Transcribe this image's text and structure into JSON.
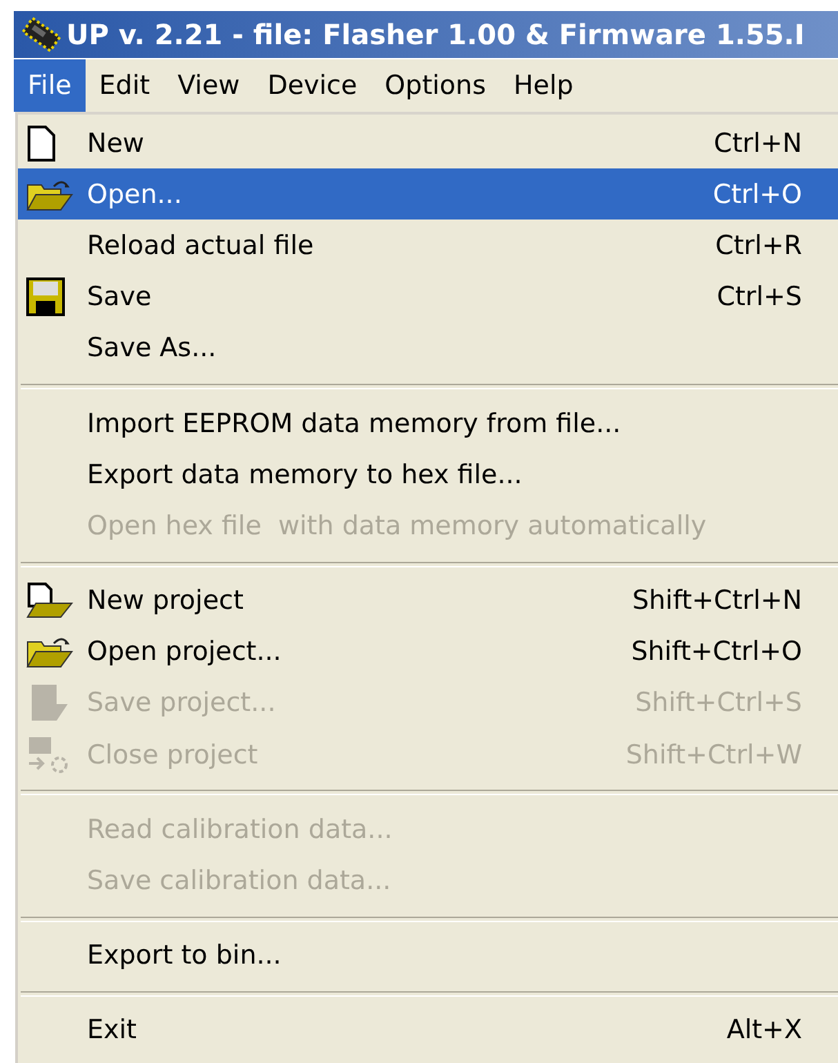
{
  "window": {
    "title": "UP v. 2.21 - file: Flasher 1.00 & Firmware 1.55.I"
  },
  "menubar": [
    {
      "label": "File",
      "selected": true
    },
    {
      "label": "Edit",
      "selected": false
    },
    {
      "label": "View",
      "selected": false
    },
    {
      "label": "Device",
      "selected": false
    },
    {
      "label": "Options",
      "selected": false
    },
    {
      "label": "Help",
      "selected": false
    }
  ],
  "menu": [
    {
      "kind": "document",
      "label": "New",
      "shortcut": "Ctrl+N",
      "selected": false,
      "disabled": false
    },
    {
      "kind": "folder",
      "label": "Open...",
      "shortcut": "Ctrl+O",
      "selected": true,
      "disabled": false
    },
    {
      "kind": "item",
      "label": "Reload actual file",
      "shortcut": "Ctrl+R",
      "selected": false,
      "disabled": false
    },
    {
      "kind": "disk",
      "label": "Save",
      "shortcut": "Ctrl+S",
      "selected": false,
      "disabled": false
    },
    {
      "kind": "item",
      "label": "Save As...",
      "selected": false,
      "disabled": false
    },
    {
      "kind": "separator"
    },
    {
      "kind": "item",
      "label": "Import EEPROM data memory from file...",
      "selected": false,
      "disabled": false
    },
    {
      "kind": "item",
      "label": "Export data memory to hex file...",
      "selected": false,
      "disabled": false
    },
    {
      "kind": "item",
      "label": "Open hex file  with data memory automatically",
      "selected": false,
      "disabled": true
    },
    {
      "kind": "separator"
    },
    {
      "kind": "new-project",
      "label": "New project",
      "shortcut": "Shift+Ctrl+N",
      "selected": false,
      "disabled": false
    },
    {
      "kind": "folder",
      "label": "Open project...",
      "shortcut": "Shift+Ctrl+O",
      "selected": false,
      "disabled": false
    },
    {
      "kind": "save-project",
      "label": "Save project...",
      "shortcut": "Shift+Ctrl+S",
      "selected": false,
      "disabled": true
    },
    {
      "kind": "close-project",
      "label": "Close project",
      "shortcut": "Shift+Ctrl+W",
      "selected": false,
      "disabled": true
    },
    {
      "kind": "separator"
    },
    {
      "kind": "item",
      "label": "Read calibration data...",
      "selected": false,
      "disabled": true
    },
    {
      "kind": "item",
      "label": "Save calibration data...",
      "selected": false,
      "disabled": true
    },
    {
      "kind": "separator"
    },
    {
      "kind": "item",
      "label": "Export to bin...",
      "selected": false,
      "disabled": false
    },
    {
      "kind": "separator"
    },
    {
      "kind": "item",
      "label": "Exit",
      "shortcut": "Alt+X",
      "selected": false,
      "disabled": false
    }
  ]
}
